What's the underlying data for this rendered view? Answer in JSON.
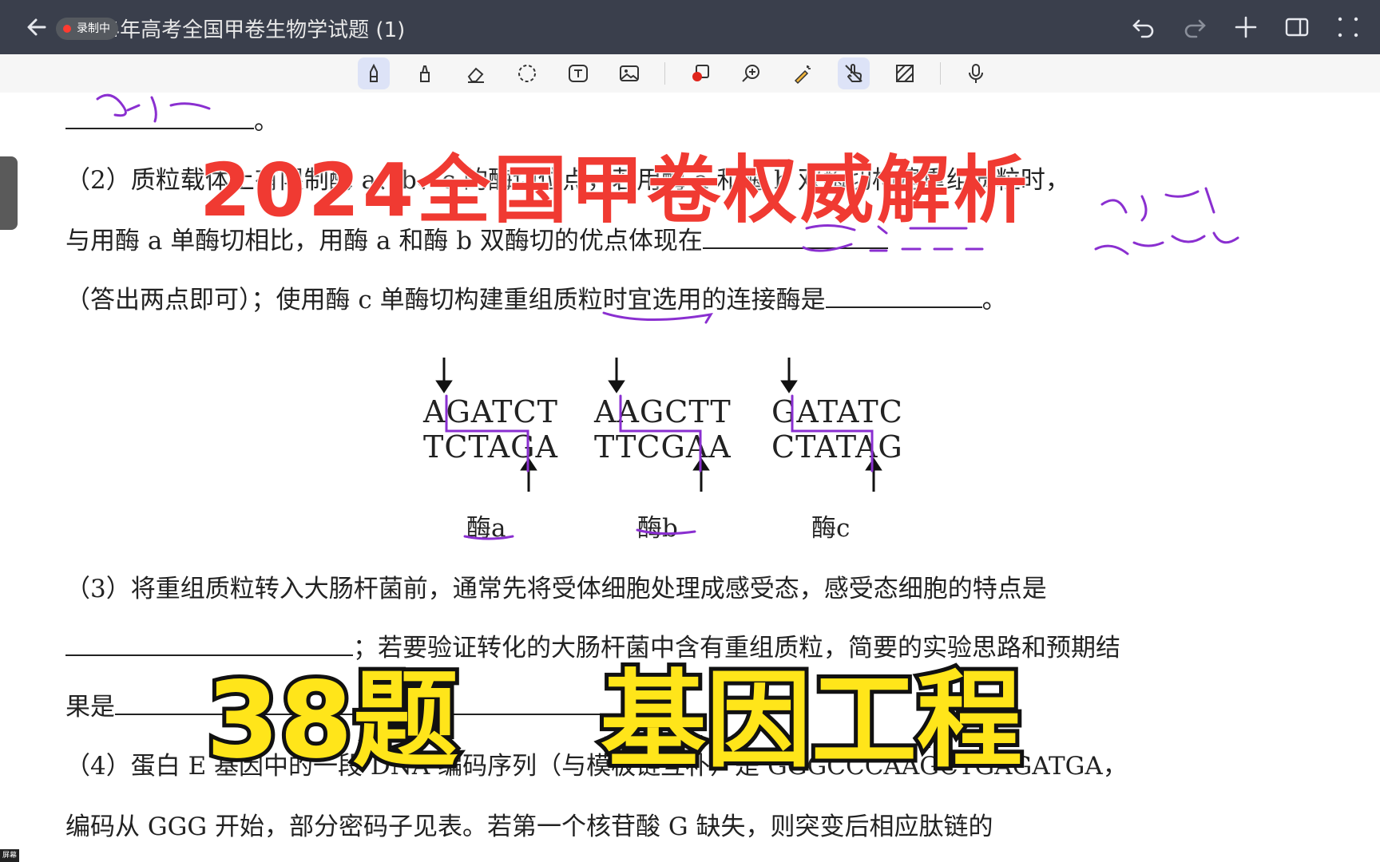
{
  "titlebar": {
    "title": "2024年高考全国甲卷生物学试题 (1)",
    "recording_label": "录制中",
    "icons": [
      "back-arrow-icon",
      "undo-icon",
      "redo-icon",
      "add-icon",
      "sidebar-panel-icon",
      "more-icon"
    ]
  },
  "toolbar": {
    "tools": [
      "pen-icon",
      "highlighter-icon",
      "eraser-icon",
      "lasso-icon",
      "text-box-icon",
      "image-icon",
      "shape-icon",
      "zoom-icon",
      "laser-pointer-icon",
      "hand-touch-icon",
      "pattern-icon",
      "microphone-icon"
    ],
    "active_tool": "hand-touch-icon"
  },
  "document": {
    "line_end_mark": "。",
    "q2_l1": "（2）质粒载体上有限制酶 a、b、c 的酶切位点，若用酶 a 和酶 b 双酶切构建重组质粒时，",
    "q2_l2_a": "与用酶 a 单酶切相比，用酶 a 和酶 b 双酶切的优点体现在",
    "q2_l3_a": "（答出两点即可）；使用酶 c 单酶切构建重组质粒时宜选用的连接酶是",
    "q2_l3_end": "。",
    "seq": {
      "a_top": "AGATCT",
      "a_bottom": "TCTAGA",
      "a_label": "酶a",
      "b_top": "AAGCTT",
      "b_bottom": "TTCGAA",
      "b_label": "酶b",
      "c_top": "GATATC",
      "c_bottom": "CTATAG",
      "c_label": "酶c"
    },
    "q3_l1": "（3）将重组质粒转入大肠杆菌前，通常先将受体细胞处理成感受态，感受态细胞的特点是",
    "q3_l2_b": "；若要验证转化的大肠杆菌中含有重组质粒，简要的实验思路和预期结",
    "q3_l3_a": "果是",
    "q4_l1": "（4）蛋白 E 基因中的一段 DNA 编码序列（与模板链互补）是 GGGCCCAAGCTGAGATGA，",
    "q4_l2": "编码从 GGG 开始，部分密码子见表。若第一个核苷酸 G 缺失，则突变后相应肽链的"
  },
  "overlays": {
    "headline": "2024全国甲卷权威解析",
    "topic_number": "38题",
    "topic_name": "基因工程"
  },
  "colors": {
    "headline_red": "#f03a32",
    "overlay_yellow": "#ffe51a",
    "ink_purple": "#8a2fd0",
    "titlebar_bg": "#3a3f4c",
    "recording_red": "#ff3b30"
  },
  "corner_badge": "屏幕"
}
